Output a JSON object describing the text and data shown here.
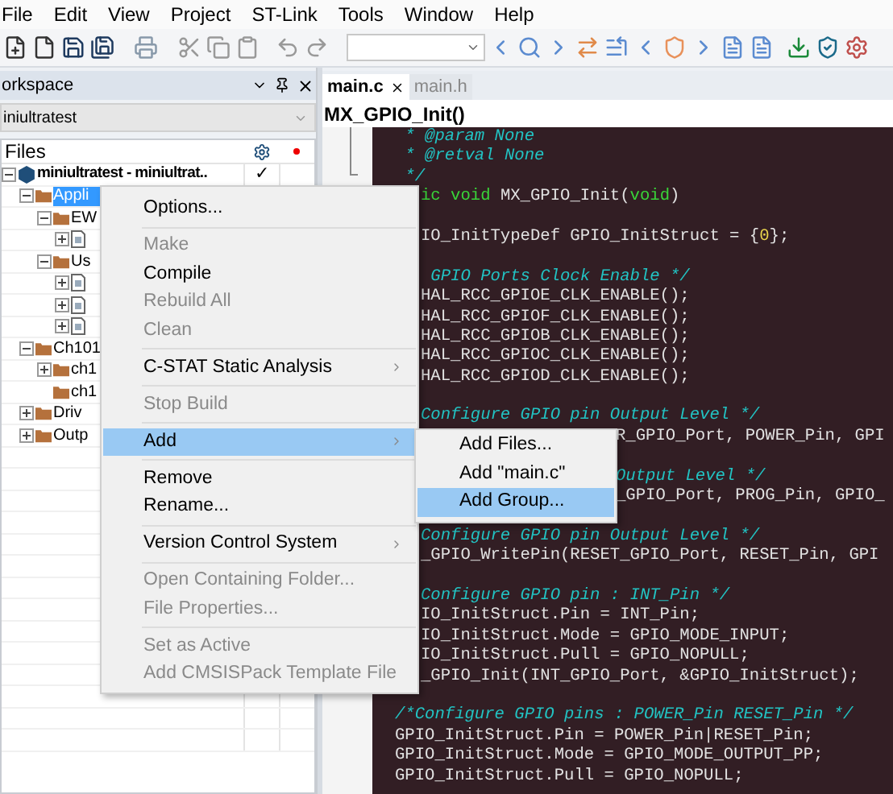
{
  "menubar": [
    "File",
    "Edit",
    "View",
    "Project",
    "ST-Link",
    "Tools",
    "Window",
    "Help"
  ],
  "workspace": {
    "title": "orkspace",
    "project_select": "iniultratest",
    "files_header": "Files",
    "tree": [
      {
        "kind": "project",
        "name": "miniultratest - miniultrat..",
        "check": "✓",
        "expanded": true,
        "selected": false,
        "children": [
          {
            "kind": "group",
            "name": "Appli",
            "expanded": true,
            "selected": true,
            "children": [
              {
                "kind": "group",
                "name": "EW",
                "expanded": true,
                "selected": false,
                "children": [
                  {
                    "kind": "file",
                    "expanded": false
                  }
                ]
              },
              {
                "kind": "group",
                "name": "Us",
                "expanded": true,
                "selected": false,
                "children": [
                  {
                    "kind": "file",
                    "expanded": false
                  },
                  {
                    "kind": "file",
                    "expanded": false
                  },
                  {
                    "kind": "file",
                    "expanded": false
                  }
                ]
              }
            ]
          },
          {
            "kind": "group",
            "name": "Ch101",
            "expanded": true,
            "selected": false,
            "children": [
              {
                "kind": "group",
                "name": "ch1",
                "expanded": false,
                "selected": false
              },
              {
                "kind": "group",
                "name": "ch1",
                "selected": false
              }
            ]
          },
          {
            "kind": "group",
            "name": "Driv",
            "expanded": false,
            "selected": false
          },
          {
            "kind": "group",
            "name": "Outp",
            "expanded": false,
            "selected": false
          }
        ]
      }
    ]
  },
  "editor": {
    "tabs": [
      {
        "label": "main.c",
        "selected": true
      },
      {
        "label": "main.h",
        "selected": false
      }
    ],
    "function": "MX_GPIO_Init()",
    "lines": [
      {
        "kind": "visible",
        "segments": [
          {
            "kind": "comment",
            "text": " * @param None"
          }
        ]
      },
      {
        "kind": "visible",
        "segments": [
          {
            "kind": "comment",
            "text": " * @retval None"
          }
        ]
      },
      {
        "kind": "visible",
        "segments": [
          {
            "kind": "comment",
            "text": " */"
          }
        ]
      },
      {
        "kind": "undermenu",
        "segments": [
          {
            "kind": "keyword",
            "text": "ic void"
          },
          {
            "kind": "plain",
            "text": " MX_GPIO_Init("
          },
          {
            "kind": "keyword",
            "text": "void"
          },
          {
            "kind": "plain",
            "text": ")"
          }
        ]
      },
      {
        "kind": "blank"
      },
      {
        "kind": "undermenu",
        "segments": [
          {
            "kind": "plain",
            "text": "IO_InitTypeDef GPIO_InitStruct = {"
          },
          {
            "kind": "number",
            "text": "0"
          },
          {
            "kind": "plain",
            "text": "};"
          }
        ]
      },
      {
        "kind": "blank"
      },
      {
        "kind": "undermenu",
        "segments": [
          {
            "kind": "comment",
            "text": " GPIO Ports Clock Enable */"
          }
        ]
      },
      {
        "kind": "undermenu",
        "segments": [
          {
            "kind": "plain",
            "text": "HAL_RCC_GPIOE_CLK_ENABLE();"
          }
        ]
      },
      {
        "kind": "undermenu",
        "segments": [
          {
            "kind": "plain",
            "text": "HAL_RCC_GPIOF_CLK_ENABLE();"
          }
        ]
      },
      {
        "kind": "undermenu",
        "segments": [
          {
            "kind": "plain",
            "text": "HAL_RCC_GPIOB_CLK_ENABLE();"
          }
        ]
      },
      {
        "kind": "undermenu",
        "segments": [
          {
            "kind": "plain",
            "text": "HAL_RCC_GPIOC_CLK_ENABLE();"
          }
        ]
      },
      {
        "kind": "undermenu",
        "segments": [
          {
            "kind": "plain",
            "text": "HAL_RCC_GPIOD_CLK_ENABLE();"
          }
        ]
      },
      {
        "kind": "blank"
      },
      {
        "kind": "undermenu",
        "segments": [
          {
            "kind": "comment",
            "text": "Configure GPIO pin Output Level */"
          }
        ]
      },
      {
        "kind": "undersubmenu",
        "segments": [
          {
            "kind": "plain",
            "text": "R_GPIO_Port, POWER_Pin, GPI"
          }
        ]
      },
      {
        "kind": "blank"
      },
      {
        "kind": "undersubmenu",
        "segments": [
          {
            "kind": "comment",
            "text": "Output Level */"
          }
        ]
      },
      {
        "kind": "undersubmenu",
        "segments": [
          {
            "kind": "plain",
            "text": "_GPIO_Port, PROG_Pin, GPIO_"
          }
        ]
      },
      {
        "kind": "blank"
      },
      {
        "kind": "undermenu",
        "segments": [
          {
            "kind": "comment",
            "text": "Configure GPIO pin Output Level */"
          }
        ]
      },
      {
        "kind": "undermenu",
        "segments": [
          {
            "kind": "plain",
            "text": "_GPIO_WritePin(RESET_GPIO_Port, RESET_Pin, GPI"
          }
        ]
      },
      {
        "kind": "blank"
      },
      {
        "kind": "undermenu",
        "segments": [
          {
            "kind": "comment",
            "text": "Configure GPIO pin : INT_Pin */"
          }
        ]
      },
      {
        "kind": "undermenu",
        "segments": [
          {
            "kind": "plain",
            "text": "IO_InitStruct.Pin = INT_Pin;"
          }
        ]
      },
      {
        "kind": "undermenu",
        "segments": [
          {
            "kind": "plain",
            "text": "IO_InitStruct.Mode = GPIO_MODE_INPUT;"
          }
        ]
      },
      {
        "kind": "undermenu",
        "segments": [
          {
            "kind": "plain",
            "text": "IO_InitStruct.Pull = GPIO_NOPULL;"
          }
        ]
      },
      {
        "kind": "undermenu",
        "segments": [
          {
            "kind": "plain",
            "text": "_GPIO_Init(INT_GPIO_Port, &GPIO_InitStruct);"
          }
        ]
      },
      {
        "kind": "blank"
      },
      {
        "kind": "visible",
        "segments": [
          {
            "kind": "comment",
            "text": "/*Configure GPIO pins : POWER_Pin RESET_Pin */"
          }
        ]
      },
      {
        "kind": "visible",
        "segments": [
          {
            "kind": "plain",
            "text": "GPIO_InitStruct.Pin = POWER_Pin|RESET_Pin;"
          }
        ]
      },
      {
        "kind": "visible",
        "segments": [
          {
            "kind": "plain",
            "text": "GPIO_InitStruct.Mode = GPIO_MODE_OUTPUT_PP;"
          }
        ]
      },
      {
        "kind": "visible",
        "segments": [
          {
            "kind": "plain",
            "text": "GPIO_InitStruct.Pull = GPIO_NOPULL;"
          }
        ]
      }
    ]
  },
  "context_menu": {
    "items": [
      {
        "kind": "item",
        "label": "Options...",
        "disabled": false,
        "submenu": false,
        "selected": false
      },
      {
        "kind": "separator"
      },
      {
        "kind": "item",
        "label": "Make",
        "disabled": true,
        "submenu": false,
        "selected": false
      },
      {
        "kind": "item",
        "label": "Compile",
        "disabled": false,
        "submenu": false,
        "selected": false
      },
      {
        "kind": "item",
        "label": "Rebuild All",
        "disabled": true,
        "submenu": false,
        "selected": false
      },
      {
        "kind": "item",
        "label": "Clean",
        "disabled": true,
        "submenu": false,
        "selected": false
      },
      {
        "kind": "separator"
      },
      {
        "kind": "item",
        "label": "C-STAT Static Analysis",
        "disabled": false,
        "submenu": true,
        "selected": false
      },
      {
        "kind": "separator"
      },
      {
        "kind": "item",
        "label": "Stop Build",
        "disabled": true,
        "submenu": false,
        "selected": false
      },
      {
        "kind": "separator"
      },
      {
        "kind": "item",
        "label": "Add",
        "disabled": false,
        "submenu": true,
        "selected": true
      },
      {
        "kind": "separator"
      },
      {
        "kind": "item",
        "label": "Remove",
        "disabled": false,
        "submenu": false,
        "selected": false
      },
      {
        "kind": "item",
        "label": "Rename...",
        "disabled": false,
        "submenu": false,
        "selected": false
      },
      {
        "kind": "separator"
      },
      {
        "kind": "item",
        "label": "Version Control System",
        "disabled": false,
        "submenu": true,
        "selected": false
      },
      {
        "kind": "separator"
      },
      {
        "kind": "item",
        "label": "Open Containing Folder...",
        "disabled": true,
        "submenu": false,
        "selected": false
      },
      {
        "kind": "item",
        "label": "File Properties...",
        "disabled": true,
        "submenu": false,
        "selected": false
      },
      {
        "kind": "separator"
      },
      {
        "kind": "item",
        "label": "Set as Active",
        "disabled": true,
        "submenu": false,
        "selected": false
      },
      {
        "kind": "item",
        "label": "Add CMSISPack Template File",
        "disabled": true,
        "submenu": false,
        "selected": false
      }
    ]
  },
  "submenu": {
    "items": [
      {
        "label": "Add Files...",
        "selected": false
      },
      {
        "label": "Add \"main.c\"",
        "selected": false
      },
      {
        "label": "Add Group...",
        "selected": true
      }
    ]
  }
}
